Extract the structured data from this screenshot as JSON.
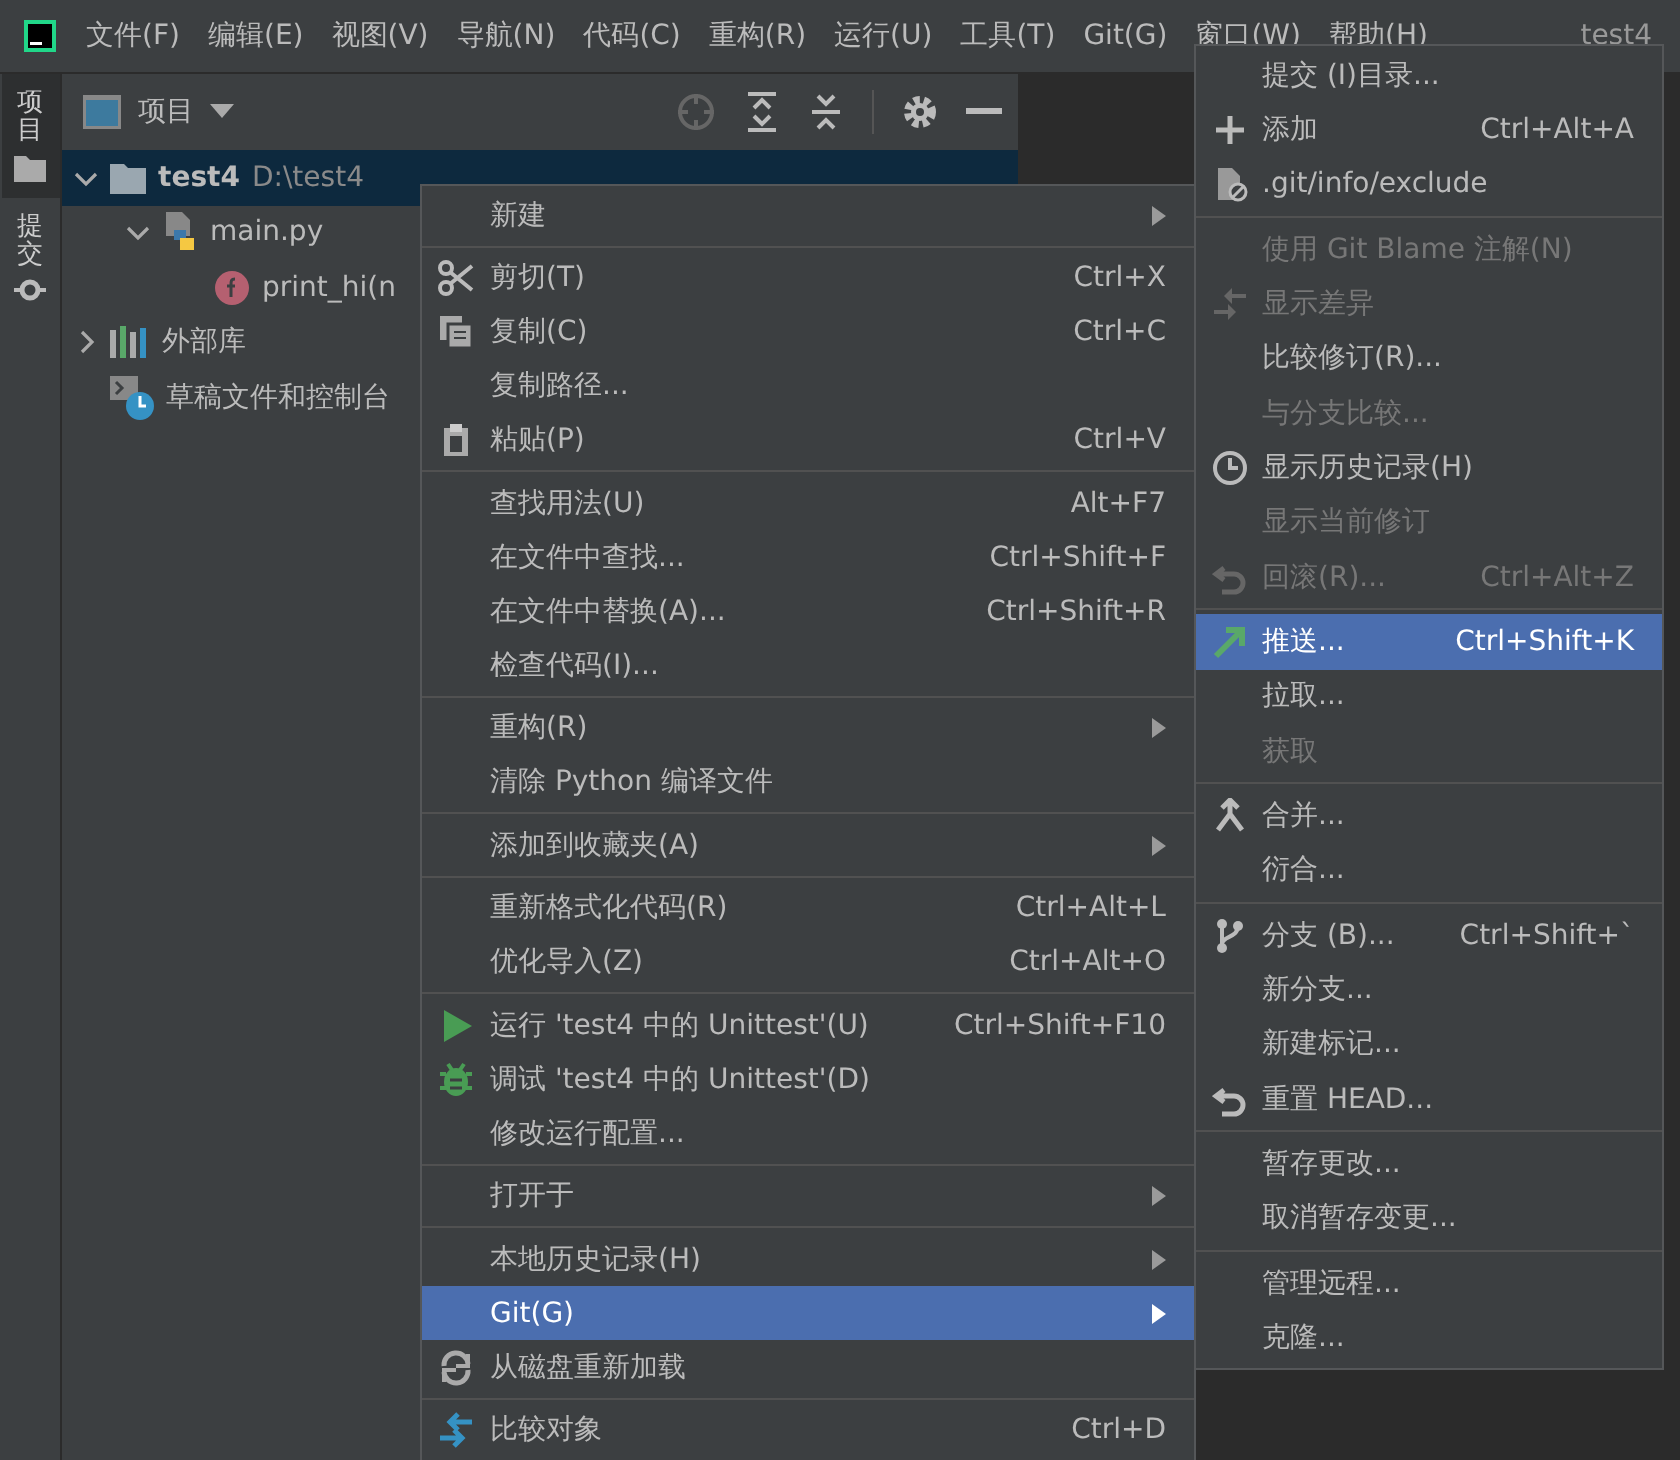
{
  "menu_bar": {
    "items": [
      "文件(F)",
      "编辑(E)",
      "视图(V)",
      "导航(N)",
      "代码(C)",
      "重构(R)",
      "运行(U)",
      "工具(T)",
      "Git(G)",
      "窗口(W)",
      "帮助(H)"
    ],
    "title": "test4"
  },
  "tool_strip": [
    {
      "label": "项目",
      "selected": true
    },
    {
      "label": "提交",
      "selected": false
    }
  ],
  "project_panel": {
    "title": "项目",
    "tree": [
      {
        "label": "test4",
        "path": "D:\\test4",
        "kind": "folder",
        "expanded": true,
        "selected": true,
        "children": [
          {
            "label": "main.py",
            "kind": "file",
            "expanded": true,
            "selected": false,
            "children": [
              {
                "label": "print_hi(n",
                "kind": "function",
                "selected": false
              }
            ]
          }
        ]
      },
      {
        "label": "外部库",
        "kind": "library",
        "expanded": false,
        "selected": false
      },
      {
        "label": "草稿文件和控制台",
        "kind": "scratch",
        "selected": false
      }
    ]
  },
  "context_menu": {
    "groups": [
      [
        {
          "label": "新建",
          "kind": "submenu",
          "selected": false
        }
      ],
      [
        {
          "label": "剪切(T)",
          "shortcut": "Ctrl+X",
          "kind": "action",
          "selected": false
        },
        {
          "label": "复制(C)",
          "shortcut": "Ctrl+C",
          "kind": "action",
          "selected": false
        },
        {
          "label": "复制路径...",
          "kind": "action",
          "selected": false
        },
        {
          "label": "粘贴(P)",
          "shortcut": "Ctrl+V",
          "kind": "action",
          "selected": false
        }
      ],
      [
        {
          "label": "查找用法(U)",
          "shortcut": "Alt+F7",
          "kind": "action",
          "selected": false
        },
        {
          "label": "在文件中查找...",
          "shortcut": "Ctrl+Shift+F",
          "kind": "action",
          "selected": false
        },
        {
          "label": "在文件中替换(A)...",
          "shortcut": "Ctrl+Shift+R",
          "kind": "action",
          "selected": false
        },
        {
          "label": "检查代码(I)...",
          "kind": "action",
          "selected": false
        }
      ],
      [
        {
          "label": "重构(R)",
          "kind": "submenu",
          "selected": false
        },
        {
          "label": "清除 Python 编译文件",
          "kind": "action",
          "selected": false
        }
      ],
      [
        {
          "label": "添加到收藏夹(A)",
          "kind": "submenu",
          "selected": false
        }
      ],
      [
        {
          "label": "重新格式化代码(R)",
          "shortcut": "Ctrl+Alt+L",
          "kind": "action",
          "selected": false
        },
        {
          "label": "优化导入(Z)",
          "shortcut": "Ctrl+Alt+O",
          "kind": "action",
          "selected": false
        }
      ],
      [
        {
          "label": "运行 'test4 中的 Unittest'(U)",
          "shortcut": "Ctrl+Shift+F10",
          "kind": "action",
          "selected": false
        },
        {
          "label": "调试 'test4 中的 Unittest'(D)",
          "kind": "action",
          "selected": false
        },
        {
          "label": "修改运行配置...",
          "kind": "action",
          "selected": false
        }
      ],
      [
        {
          "label": "打开于",
          "kind": "submenu",
          "selected": false
        }
      ],
      [
        {
          "label": "本地历史记录(H)",
          "kind": "submenu",
          "selected": false
        },
        {
          "label": "Git(G)",
          "kind": "submenu",
          "selected": true
        },
        {
          "label": "从磁盘重新加载",
          "kind": "action",
          "selected": false
        }
      ],
      [
        {
          "label": "比较对象",
          "shortcut": "Ctrl+D",
          "kind": "action",
          "selected": false
        }
      ]
    ]
  },
  "git_submenu": {
    "groups": [
      [
        {
          "label": "提交 (I)目录...",
          "disabled": false,
          "selected": false
        },
        {
          "label": "添加",
          "shortcut": "Ctrl+Alt+A",
          "disabled": false,
          "selected": false
        },
        {
          "label": ".git/info/exclude",
          "disabled": false,
          "selected": false
        }
      ],
      [
        {
          "label": "使用 Git Blame 注解(N)",
          "disabled": true,
          "selected": false
        },
        {
          "label": "显示差异",
          "disabled": true,
          "selected": false
        },
        {
          "label": "比较修订(R)...",
          "disabled": false,
          "selected": false
        },
        {
          "label": "与分支比较...",
          "disabled": true,
          "selected": false
        },
        {
          "label": "显示历史记录(H)",
          "disabled": false,
          "selected": false
        },
        {
          "label": "显示当前修订",
          "disabled": true,
          "selected": false
        },
        {
          "label": "回滚(R)...",
          "shortcut": "Ctrl+Alt+Z",
          "disabled": true,
          "selected": false
        }
      ],
      [
        {
          "label": "推送...",
          "shortcut": "Ctrl+Shift+K",
          "disabled": false,
          "selected": true
        },
        {
          "label": "拉取...",
          "disabled": false,
          "selected": false
        },
        {
          "label": "获取",
          "disabled": true,
          "selected": false
        }
      ],
      [
        {
          "label": "合并...",
          "disabled": false,
          "selected": false
        },
        {
          "label": "衍合...",
          "disabled": false,
          "selected": false
        }
      ],
      [
        {
          "label": "分支 (B)...",
          "shortcut": "Ctrl+Shift+`",
          "disabled": false,
          "selected": false
        },
        {
          "label": "新分支...",
          "disabled": false,
          "selected": false
        },
        {
          "label": "新建标记...",
          "disabled": false,
          "selected": false
        },
        {
          "label": "重置 HEAD...",
          "disabled": false,
          "selected": false
        }
      ],
      [
        {
          "label": "暂存更改...",
          "disabled": false,
          "selected": false
        },
        {
          "label": "取消暂存变更...",
          "disabled": false,
          "selected": false
        }
      ],
      [
        {
          "label": "管理远程...",
          "disabled": false,
          "selected": false
        },
        {
          "label": "克隆...",
          "disabled": false,
          "selected": false
        }
      ]
    ]
  }
}
